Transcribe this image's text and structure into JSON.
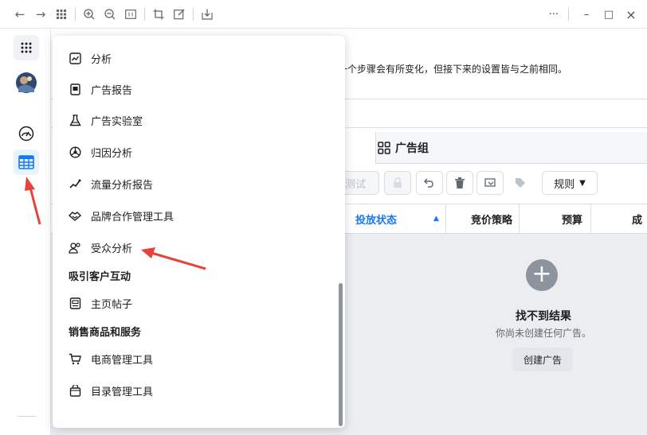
{
  "toolbar": {
    "icons": [
      "back-arrow-icon",
      "forward-arrow-icon",
      "grid-icon",
      "zoom-in-icon",
      "zoom-out-icon",
      "fit-icon",
      "crop-icon",
      "edit-icon",
      "download-icon"
    ],
    "more": "···",
    "minimize": "–",
    "maximize": "□",
    "close": "×"
  },
  "notice": {
    "text": "一个步骤会有所变化，但接下来的设置皆与之前相同。"
  },
  "tabs": {
    "ad_group": "广告组"
  },
  "actions": {
    "test": "测试",
    "rules": "规则"
  },
  "table": {
    "columns": [
      "投放状态",
      "竞价策略",
      "预算",
      "成"
    ]
  },
  "empty_state": {
    "title": "找不到结果",
    "subtitle": "你尚未创建任何广告。",
    "button": "创建广告"
  },
  "menu": {
    "items_top": [
      {
        "label": "分析",
        "icon": "chart-icon"
      },
      {
        "label": "广告报告",
        "icon": "report-icon"
      },
      {
        "label": "广告实验室",
        "icon": "flask-icon"
      },
      {
        "label": "归因分析",
        "icon": "attribution-icon"
      },
      {
        "label": "流量分析报告",
        "icon": "traffic-icon"
      },
      {
        "label": "品牌合作管理工具",
        "icon": "handshake-icon"
      },
      {
        "label": "受众分析",
        "icon": "audience-icon"
      }
    ],
    "section_engage": "吸引客户互动",
    "items_engage": [
      {
        "label": "主页帖子",
        "icon": "page-post-icon"
      }
    ],
    "section_sell": "销售商品和服务",
    "items_sell": [
      {
        "label": "电商管理工具",
        "icon": "cart-icon"
      },
      {
        "label": "目录管理工具",
        "icon": "catalog-icon"
      }
    ]
  },
  "colors": {
    "accent": "#1877f2",
    "annotation": "#e8433a"
  }
}
